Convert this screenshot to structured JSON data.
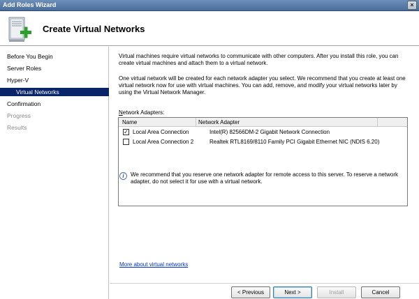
{
  "window": {
    "title": "Add Roles Wizard",
    "close_glyph": "×"
  },
  "header": {
    "page_title": "Create Virtual Networks",
    "icon": "server-add-icon"
  },
  "sidebar": {
    "items": [
      {
        "label": "Before You Begin",
        "state": "normal"
      },
      {
        "label": "Server Roles",
        "state": "normal"
      },
      {
        "label": "Hyper-V",
        "state": "normal"
      },
      {
        "label": "Virtual Networks",
        "state": "selected"
      },
      {
        "label": "Confirmation",
        "state": "normal"
      },
      {
        "label": "Progress",
        "state": "disabled"
      },
      {
        "label": "Results",
        "state": "disabled"
      }
    ]
  },
  "main": {
    "intro_1": "Virtual machines require virtual networks to communicate with other computers. After you install this role, you can create virtual machines and attach them to a virtual network.",
    "intro_2": "One virtual network will be created for each network adapter you select. We recommend that you create at least one virtual network now for use with virtual machines. You can add, remove, and modify your virtual networks later by using the Virtual Network Manager.",
    "adapters_label_mnemonic": "N",
    "adapters_label_rest": "etwork Adapters:",
    "columns": {
      "name": "Name",
      "adapter": "Network Adapter"
    },
    "rows": [
      {
        "checked": true,
        "name": "Local Area Connection",
        "adapter": "Intel(R) 82566DM-2 Gigabit Network Connection"
      },
      {
        "checked": false,
        "name": "Local Area Connection 2",
        "adapter": "Realtek RTL8169/8110 Family PCI Gigabit Ethernet NIC (NDIS 6.20)"
      }
    ],
    "info_glyph": "i",
    "info_text": "We recommend that you reserve one network adapter for remote access to this server. To reserve a network adapter, do not select it for use with a virtual network.",
    "more_link": "More about virtual networks"
  },
  "footer": {
    "previous": "< Previous",
    "next": "Next >",
    "install": "Install",
    "cancel": "Cancel"
  },
  "colors": {
    "selection": "#0a246a",
    "link": "#0033cc",
    "titlebar": "#5a7eab"
  }
}
